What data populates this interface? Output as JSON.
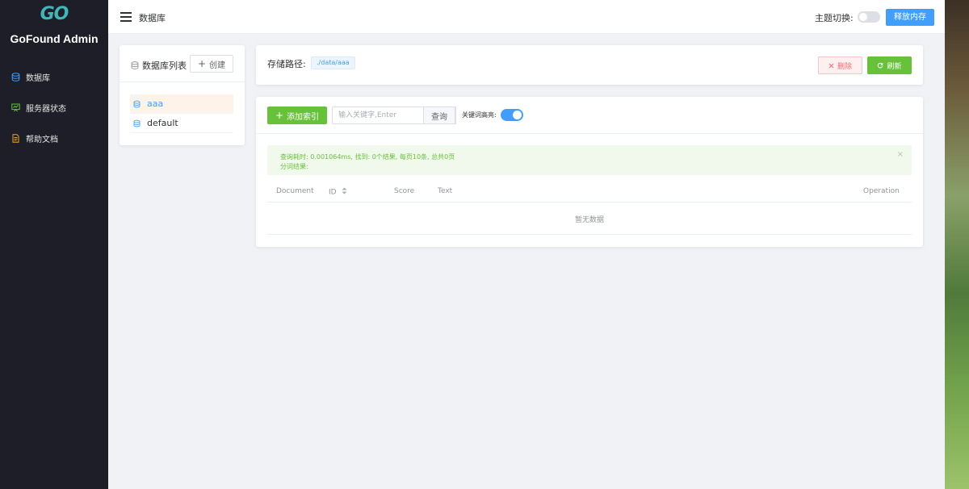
{
  "sidebar": {
    "logo_mark": "GO",
    "app_name": "GoFound Admin",
    "items": [
      {
        "label": "数据库",
        "icon": "database-icon"
      },
      {
        "label": "服务器状态",
        "icon": "monitor-icon"
      },
      {
        "label": "帮助文档",
        "icon": "document-icon"
      }
    ]
  },
  "header": {
    "title": "数据库",
    "theme_label": "主题切换:",
    "theme_on": false,
    "free_memory_label": "释放内存"
  },
  "db_panel": {
    "title": "数据库列表",
    "create_label": "创建",
    "items": [
      "aaa",
      "default"
    ],
    "active_index": 0
  },
  "path_card": {
    "label": "存储路径:",
    "path": "./data/aaa",
    "delete_label": "删除",
    "refresh_label": "刷新"
  },
  "index_card": {
    "add_index_label": "添加索引",
    "search_placeholder": "输入关键字,Enter",
    "search_value": "",
    "query_label": "查询",
    "highlight_label": "关键词高亮:",
    "highlight_on": true,
    "alert_line1": "查询耗时: 0.001064ms, 找到: 0个结果, 每页10条, 总共0页",
    "alert_line2": "分词结果:",
    "columns": [
      "Document",
      "ID",
      "Score",
      "Text",
      "Operation"
    ],
    "empty_text": "暂无数据"
  },
  "colors": {
    "sidebar_bg": "#1d1e27",
    "primary": "#409eff",
    "success": "#67c23a",
    "danger": "#f56c6c",
    "logo": "#3fb6b7"
  }
}
